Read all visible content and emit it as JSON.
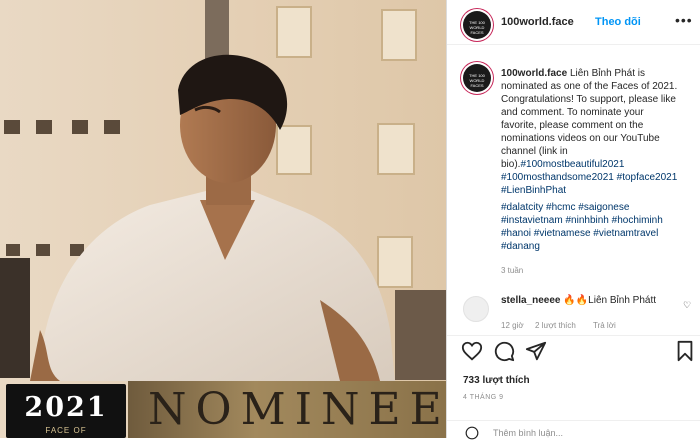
{
  "post": {
    "image": {
      "badge_year": "2021",
      "badge_sub": "FACE OF",
      "nominee": "NOMINEE"
    },
    "header": {
      "username": "100world.face",
      "follow_label": "Theo dõi",
      "avatar_text": "THE 100 WORLD FACES",
      "more_icon": "ellipsis-icon"
    },
    "caption": {
      "username": "100world.face",
      "lines": [
        "Liên Bỉnh Phát is",
        "nominated as one of the Faces of 2021.",
        "Congratulations! To support, please like",
        "and comment. To nominate your",
        "favorite, please comment on the",
        "nominations videos on our YouTube",
        "channel (link in",
        "bio).",
        "#100mosthandsome2021 #topface2021",
        "#LienBinhPhat",
        "#dalatcity #hcmc #saigonese",
        "#instavietnam #ninhbinh #hochiminh",
        "#hanoi #vietnamese #vietnamtravel",
        "#danang"
      ],
      "tag_on_line8": "#100mostbeautiful2021",
      "time": "3 tuần"
    },
    "comment": {
      "username": "stella_neeee",
      "text": "🔥🔥Liên Bỉnh Phátt",
      "time": "12 giờ",
      "likes": "2 lượt thích",
      "reply": "Trả lời"
    },
    "likes": "733 lượt thích",
    "date": "4 THÁNG 9",
    "comment_placeholder": "Thêm bình luận...",
    "icons": {
      "like": "heart-icon",
      "comment": "comment-icon",
      "share": "share-icon",
      "save": "bookmark-icon",
      "emoji": "emoji-icon"
    }
  }
}
